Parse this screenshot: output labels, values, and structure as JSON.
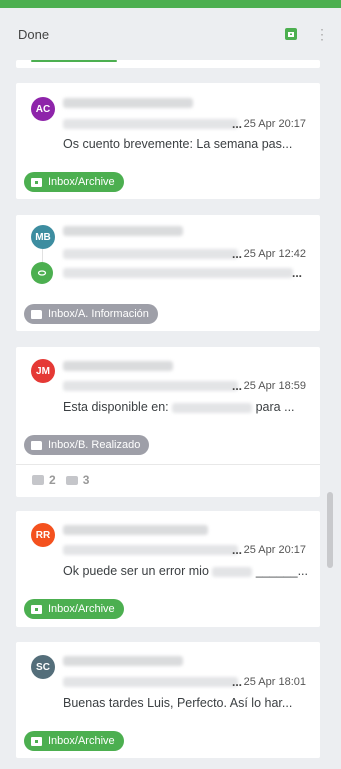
{
  "header": {
    "title": "Done",
    "archive_icon": "archive-icon",
    "more_icon": "more-vertical-icon",
    "accent": "#4caf50"
  },
  "messages": [
    {
      "initials": "AC",
      "avatar_color": "#8e24aa",
      "date": "25 Apr 20:17",
      "snippet": "Os cuento brevemente: La semana pas...",
      "tag": "Inbox/Archive"
    },
    {
      "initials": "MB",
      "avatar_color": "#3d8da0",
      "date": "25 Apr 12:42",
      "tag": "Inbox/A. Información"
    },
    {
      "initials": "JM",
      "avatar_color": "#e53935",
      "date": "25 Apr 18:59",
      "snippet_start": "Esta disponible en:",
      "snippet_end": "para ...",
      "tag": "Inbox/B. Realizado",
      "stats": {
        "notes": "2",
        "stack": "3"
      }
    },
    {
      "initials": "RR",
      "avatar_color": "#f4511e",
      "date": "25 Apr 20:17",
      "snippet_start": "Ok puede ser un error mio",
      "snippet_end": "______...",
      "tag": "Inbox/Archive"
    },
    {
      "initials": "SC",
      "avatar_color": "#546e7a",
      "date": "25 Apr 18:01",
      "snippet": "Buenas tardes Luis, Perfecto. Así lo har...",
      "tag": "Inbox/Archive"
    }
  ],
  "ellipsis": "..."
}
